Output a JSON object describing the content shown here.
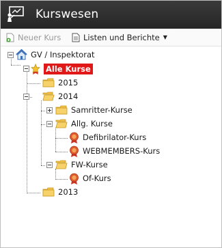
{
  "header": {
    "title": "Kurswesen",
    "icon": "presentation-icon"
  },
  "toolbar": {
    "new_course": "Neuer Kurs",
    "lists_reports": "Listen und Berichte"
  },
  "tree": {
    "root": "GV / Inspektorat",
    "all_courses": "Alle Kurse",
    "year_2015": "2015",
    "year_2014": "2014",
    "samritter": "Samritter-Kurse",
    "allg": "Allg. Kurse",
    "defibrilator": "Defibrilator-Kurs",
    "webmembers": "WEBMEMBERS-Kurs",
    "fw": "FW-Kurse",
    "of": "Of-Kurs",
    "year_2013": "2013"
  },
  "colors": {
    "selected_bg": "#e01818",
    "header_bg": "#2f2f2f",
    "folder": "#f2c24b"
  }
}
